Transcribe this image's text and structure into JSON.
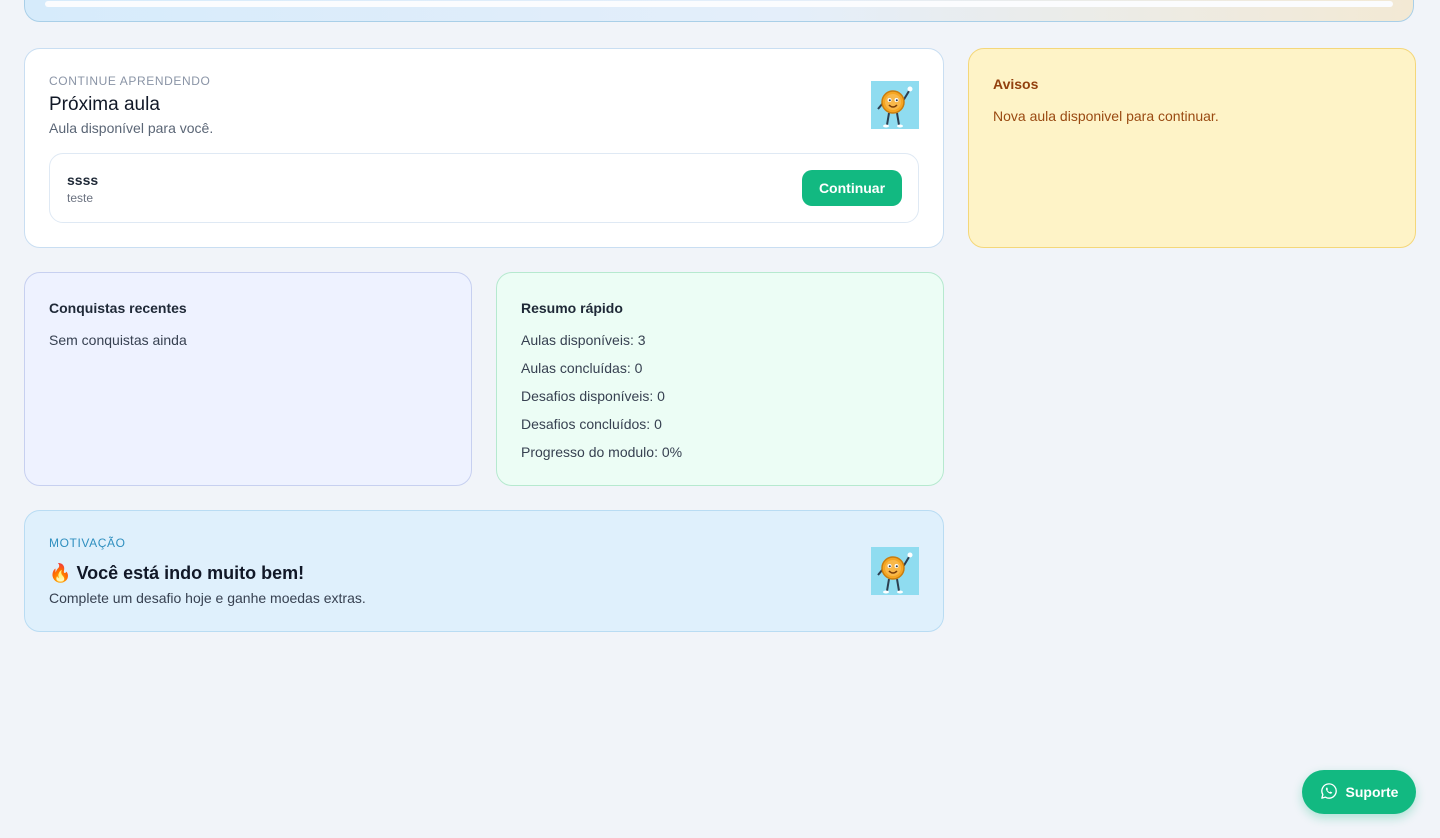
{
  "continue_card": {
    "eyebrow": "CONTINUE APRENDENDO",
    "title": "Próxima aula",
    "subtitle": "Aula disponível para você.",
    "lesson": {
      "title": "ssss",
      "subtitle": "teste",
      "button_label": "Continuar"
    }
  },
  "notices": {
    "heading": "Avisos",
    "text": "Nova aula disponivel para continuar."
  },
  "achievements": {
    "heading": "Conquistas recentes",
    "text": "Sem conquistas ainda"
  },
  "summary": {
    "heading": "Resumo rápido",
    "items": [
      "Aulas disponíveis: 3",
      "Aulas concluídas: 0",
      "Desafios disponíveis: 0",
      "Desafios concluídos: 0",
      "Progresso do modulo: 0%"
    ]
  },
  "motivation": {
    "eyebrow": "MOTIVAÇÃO",
    "emoji": "🔥",
    "title": "Você está indo muito bem!",
    "subtitle": "Complete um desafio hoje e ganhe moedas extras."
  },
  "support_button": {
    "label": "Suporte",
    "icon": "whatsapp-icon"
  },
  "colors": {
    "accent": "#12b981",
    "page_background": "#f1f4f9",
    "notice_background": "#fef3c7"
  }
}
